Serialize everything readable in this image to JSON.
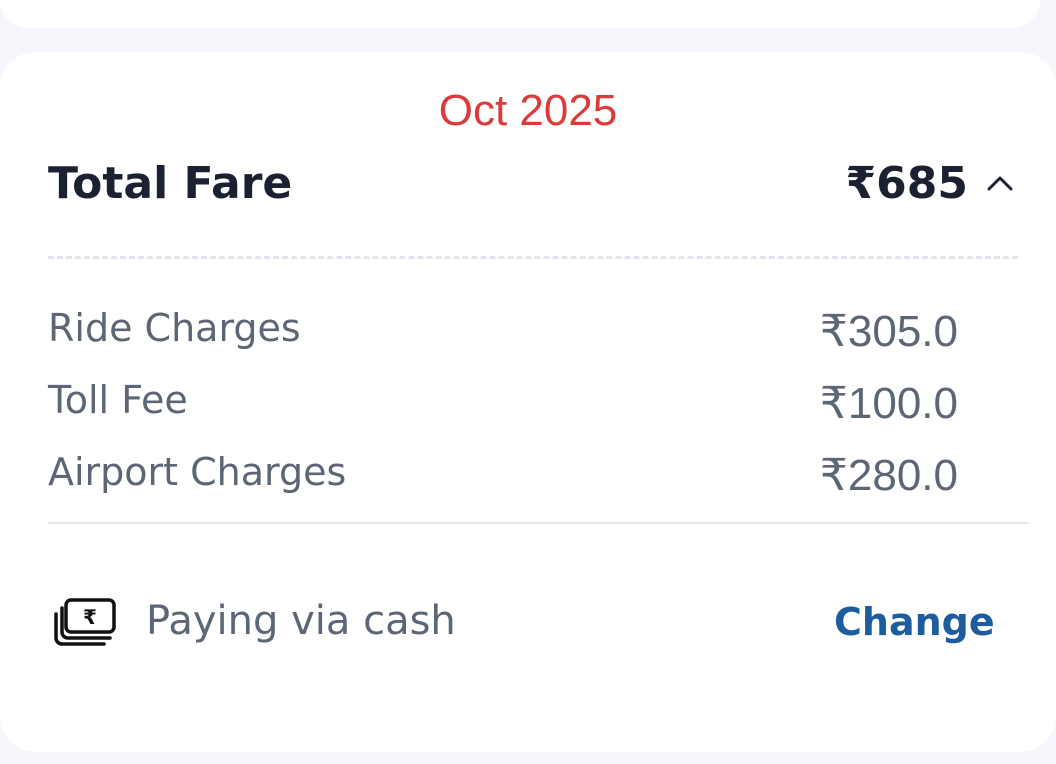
{
  "header": {
    "date_label": "Oct 2025"
  },
  "fare": {
    "total_label": "Total Fare",
    "total_value": "₹685",
    "items": [
      {
        "label": "Ride Charges",
        "value": "₹305.0"
      },
      {
        "label": "Toll Fee",
        "value": "₹100.0"
      },
      {
        "label": "Airport Charges",
        "value": "₹280.0"
      }
    ]
  },
  "payment": {
    "text": "Paying via cash",
    "change_label": "Change",
    "icon": "cash-rupee-icon"
  },
  "colors": {
    "date": "#dc3b3b",
    "primary_text": "#1b2130",
    "secondary_text": "#5d6675",
    "accent": "#1d5c9e"
  }
}
